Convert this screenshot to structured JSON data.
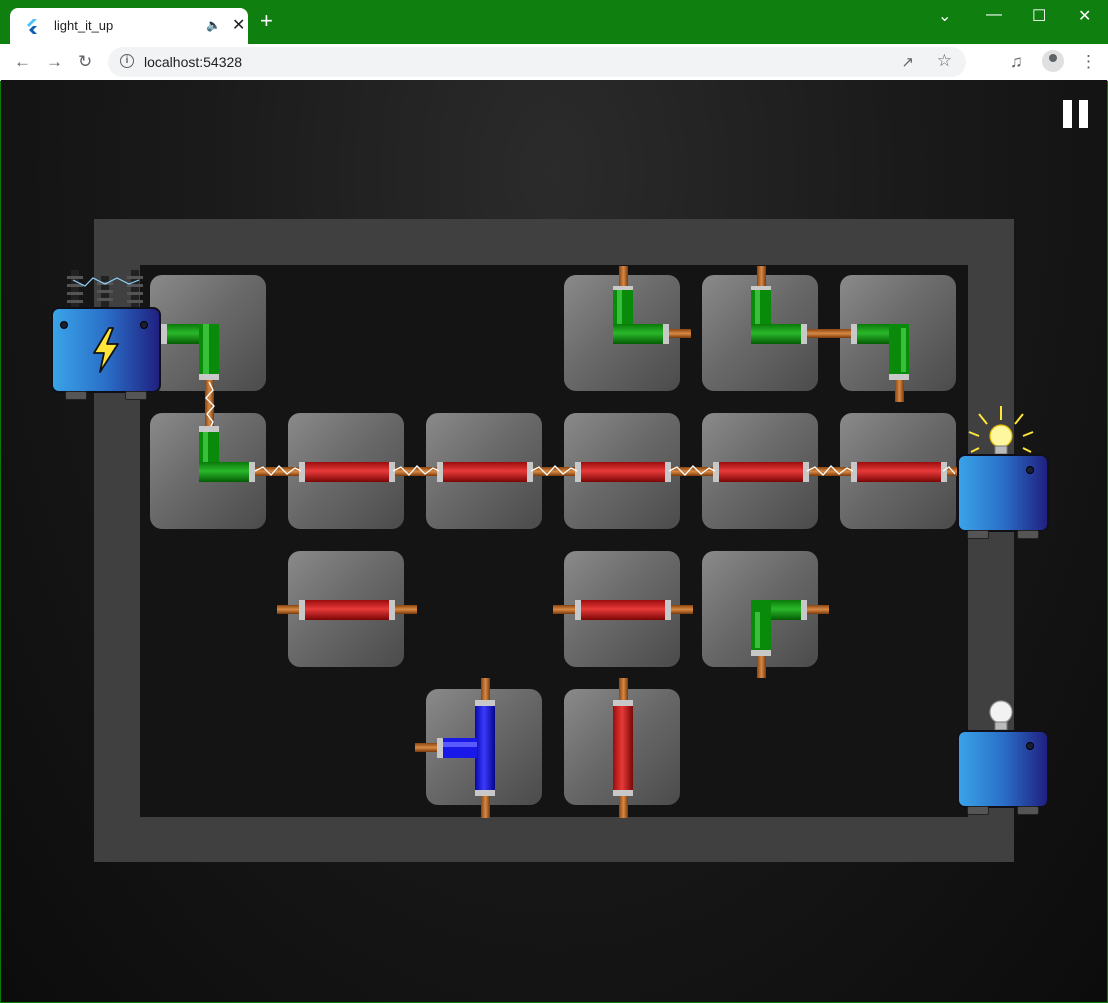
{
  "browser": {
    "tab_title": "light_it_up",
    "url": "localhost:54328",
    "new_tab_label": "+",
    "window_controls": [
      "chevron-down",
      "minimize",
      "maximize",
      "close"
    ]
  },
  "game": {
    "pause_icon": "pause-icon",
    "colors": {
      "frame": "#404040",
      "board": "#141414",
      "pipe_green": "#0a8a0a",
      "pipe_red": "#c81414",
      "pipe_blue": "#1010e0",
      "copper": "#b8651b",
      "source_box": "#2a6fc8",
      "bulb_lit": "#ffe43a"
    },
    "board": {
      "rows": 4,
      "cols": 6
    },
    "tiles": [
      {
        "row": 0,
        "col": 0,
        "pipe": "elbow",
        "color": "green",
        "powered": true
      },
      {
        "row": 0,
        "col": 3,
        "pipe": "elbow",
        "color": "green",
        "powered": false
      },
      {
        "row": 0,
        "col": 4,
        "pipe": "elbow",
        "color": "green",
        "powered": false
      },
      {
        "row": 0,
        "col": 5,
        "pipe": "elbow",
        "color": "green",
        "powered": false
      },
      {
        "row": 1,
        "col": 0,
        "pipe": "elbow",
        "color": "green",
        "powered": true
      },
      {
        "row": 1,
        "col": 1,
        "pipe": "straight",
        "color": "red",
        "powered": true
      },
      {
        "row": 1,
        "col": 2,
        "pipe": "straight",
        "color": "red",
        "powered": true
      },
      {
        "row": 1,
        "col": 3,
        "pipe": "straight",
        "color": "red",
        "powered": true
      },
      {
        "row": 1,
        "col": 4,
        "pipe": "straight",
        "color": "red",
        "powered": true
      },
      {
        "row": 1,
        "col": 5,
        "pipe": "straight",
        "color": "red",
        "powered": true
      },
      {
        "row": 2,
        "col": 1,
        "pipe": "straight",
        "color": "red",
        "powered": false
      },
      {
        "row": 2,
        "col": 3,
        "pipe": "straight",
        "color": "red",
        "powered": false
      },
      {
        "row": 2,
        "col": 4,
        "pipe": "elbow",
        "color": "green",
        "powered": false
      },
      {
        "row": 3,
        "col": 2,
        "pipe": "tee",
        "color": "blue",
        "powered": false
      },
      {
        "row": 3,
        "col": 3,
        "pipe": "straight",
        "color": "red",
        "powered": false
      }
    ],
    "power_source": {
      "icon": "lightning-bolt-icon"
    },
    "bulbs": [
      {
        "name": "bulb-1",
        "lit": true
      },
      {
        "name": "bulb-2",
        "lit": false
      }
    ]
  }
}
